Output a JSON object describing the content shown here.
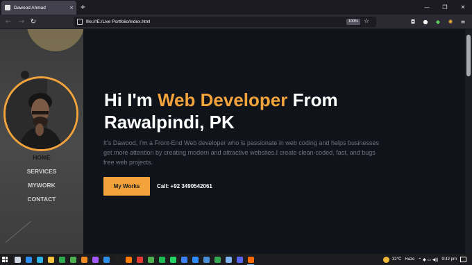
{
  "browser": {
    "tab_title": "Dawood Ahmad",
    "tab_close": "×",
    "new_tab": "+",
    "window_controls": [
      "—",
      "❐",
      "✕"
    ],
    "url": "file:///E:/Live Portfolio/index.html",
    "zoom": "100%"
  },
  "sidebar": {
    "nav": [
      {
        "label": "HOME",
        "active": true
      },
      {
        "label": "SERVICES",
        "active": false
      },
      {
        "label": "MYWORK",
        "active": false
      },
      {
        "label": "CONTACT",
        "active": false
      }
    ]
  },
  "hero": {
    "headline_pre": "Hi I'm ",
    "headline_accent": "Web Developer",
    "headline_post": " From Rawalpindi, PK",
    "intro": "It's Dawood, I'm a Front-End Web developer who is passionate in web coding and helps businesses get more attention by creating modern and attractive websites.I create clean-coded, fast, and bugs free web projects.",
    "cta_label": "My Works",
    "call_text": "Call: +92 3490542061"
  },
  "colors": {
    "accent": "#f2a33c",
    "page_bg": "#10131a",
    "sidebar_bg": "#404040"
  },
  "taskbar": {
    "apps": [
      {
        "name": "task-view-icon",
        "color": "#cfd8e3"
      },
      {
        "name": "dropbox-icon",
        "color": "#2f8cf0"
      },
      {
        "name": "edge-icon",
        "color": "#2fb3e6"
      },
      {
        "name": "file-explorer-icon",
        "color": "#f3c33b"
      },
      {
        "name": "app-star-icon",
        "color": "#2fa84f"
      },
      {
        "name": "app-green-icon",
        "color": "#4caf50"
      },
      {
        "name": "vlc-icon",
        "color": "#f08a24"
      },
      {
        "name": "figma-icon",
        "color": "#a259ff"
      },
      {
        "name": "vscode-icon",
        "color": "#2d8ee8"
      },
      {
        "name": "notepad-icon",
        "color": "#1f1f1f"
      },
      {
        "name": "illustrator-icon",
        "color": "#ff7c00"
      },
      {
        "name": "record-icon",
        "color": "#e53935"
      },
      {
        "name": "chrome-icon",
        "color": "#4caf50"
      },
      {
        "name": "spotify-icon",
        "color": "#1db954"
      },
      {
        "name": "whatsapp-icon",
        "color": "#25d366"
      },
      {
        "name": "messenger-icon",
        "color": "#3b82f6"
      },
      {
        "name": "zoom-icon",
        "color": "#2d8cff"
      },
      {
        "name": "app-blue-icon",
        "color": "#4a90d9"
      },
      {
        "name": "sheets-icon",
        "color": "#34a853"
      },
      {
        "name": "app-light-icon",
        "color": "#7fb3f0"
      },
      {
        "name": "discord-icon",
        "color": "#5865f2"
      },
      {
        "name": "firefox-icon",
        "color": "#ff6a00"
      }
    ],
    "temperature": "32°C",
    "weather": "Haze",
    "tray_symbols": "⌃ ◆ ▭ ◀))",
    "time": "9:42 pm"
  }
}
